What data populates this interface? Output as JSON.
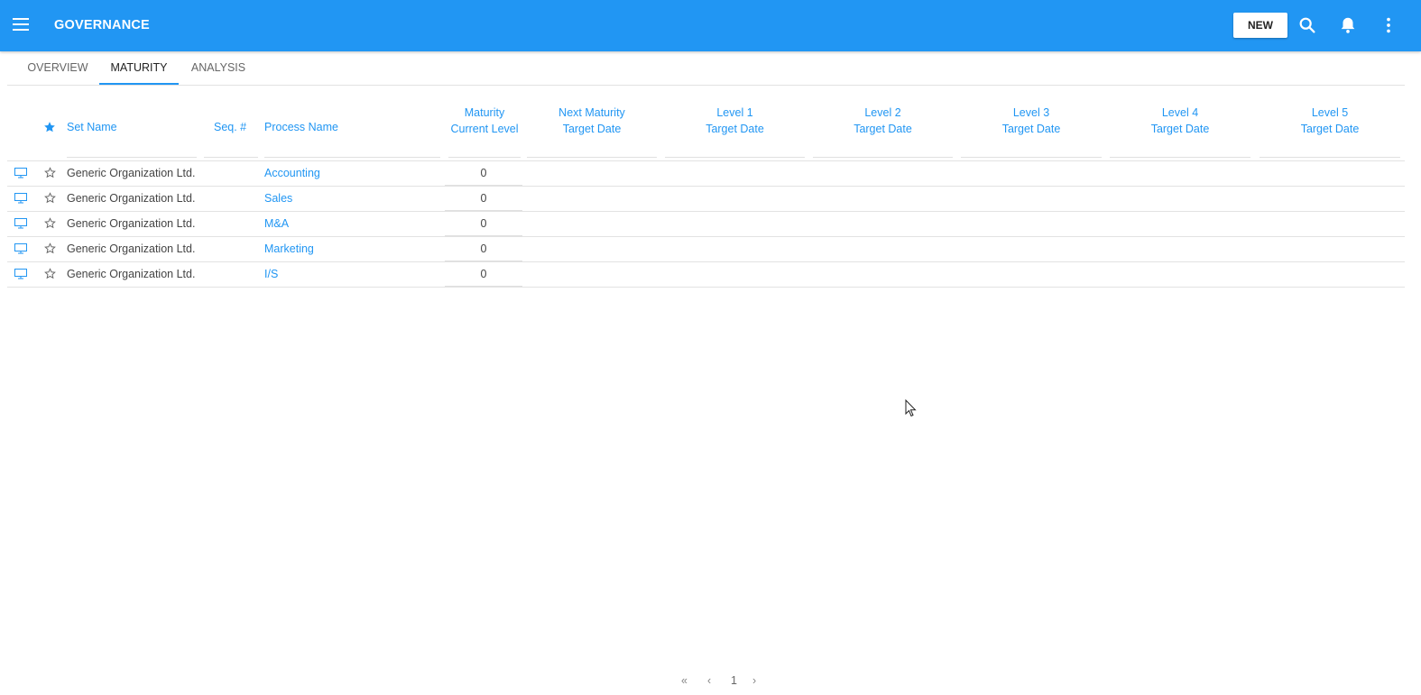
{
  "appbar": {
    "title": "GOVERNANCE",
    "new_label": "NEW",
    "accent": "#2196f3"
  },
  "tabs": [
    {
      "label": "OVERVIEW",
      "active": false
    },
    {
      "label": "MATURITY",
      "active": true
    },
    {
      "label": "ANALYSIS",
      "active": false
    }
  ],
  "table": {
    "columns": {
      "set_name": "Set Name",
      "seq": "Seq. #",
      "process_name": "Process Name",
      "maturity_line1": "Maturity",
      "maturity_line2": "Current Level",
      "next_line1": "Next Maturity",
      "next_line2": "Target Date",
      "l1_line1": "Level 1",
      "l2_line1": "Level 2",
      "l3_line1": "Level 3",
      "l4_line1": "Level 4",
      "l5_line1": "Level 5",
      "target_date": "Target Date"
    },
    "rows": [
      {
        "set_name": "Generic Organization Ltd.",
        "seq": "",
        "process_name": "Accounting",
        "current_level": "0"
      },
      {
        "set_name": "Generic Organization Ltd.",
        "seq": "",
        "process_name": "Sales",
        "current_level": "0"
      },
      {
        "set_name": "Generic Organization Ltd.",
        "seq": "",
        "process_name": "M&A",
        "current_level": "0"
      },
      {
        "set_name": "Generic Organization Ltd.",
        "seq": "",
        "process_name": "Marketing",
        "current_level": "0"
      },
      {
        "set_name": "Generic Organization Ltd.",
        "seq": "",
        "process_name": "I/S",
        "current_level": "0"
      }
    ]
  },
  "pager": {
    "first": "«",
    "prev": "‹",
    "page": "1",
    "next": "›"
  }
}
